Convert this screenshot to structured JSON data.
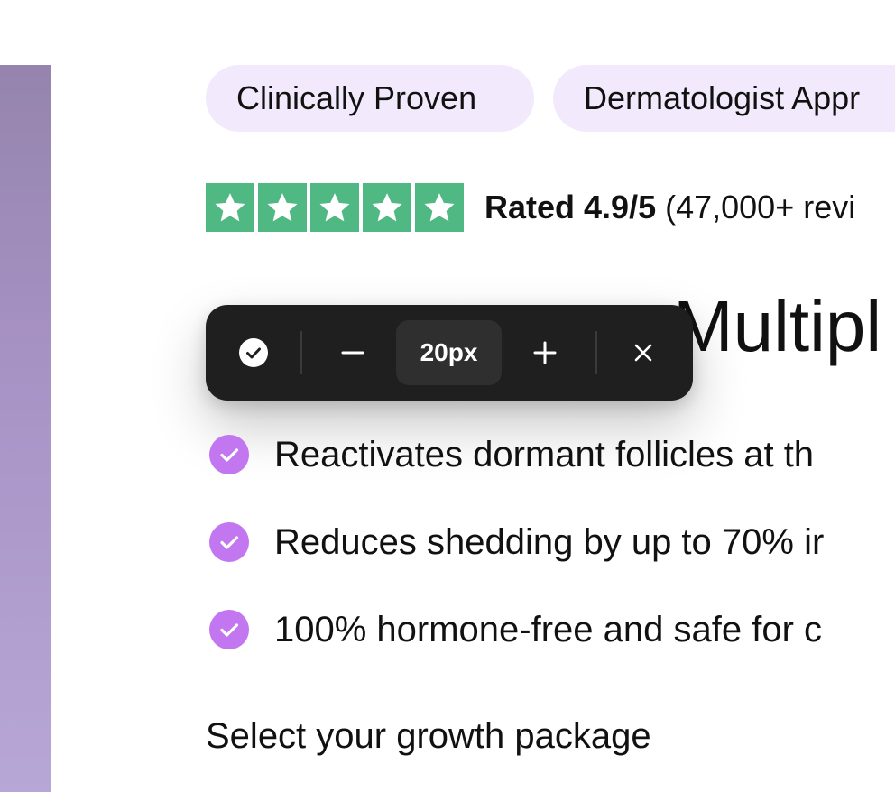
{
  "tags": [
    "Clinically Proven",
    "Dermatologist Appr"
  ],
  "rating": {
    "stars": 5,
    "star_color": "#4fb883",
    "label_bold": "Rated 4.9/5",
    "label_rest": " (47,000+ revi"
  },
  "headline": "Multipl",
  "toolbar": {
    "confirm_icon": "check-circle-icon",
    "minus_icon": "minus-icon",
    "value": "20px",
    "plus_icon": "plus-icon",
    "close_icon": "close-icon"
  },
  "features": [
    "Reactivates dormant follicles at th",
    "Reduces shedding by up to 70% ir",
    "100% hormone-free and safe for c"
  ],
  "feature_check_color": "#c277f0",
  "section_title": "Select your growth package",
  "colors": {
    "tag_bg": "#f3e9fc",
    "toolbar_bg": "#1f1f1f",
    "accent_purple": "#c277f0"
  }
}
